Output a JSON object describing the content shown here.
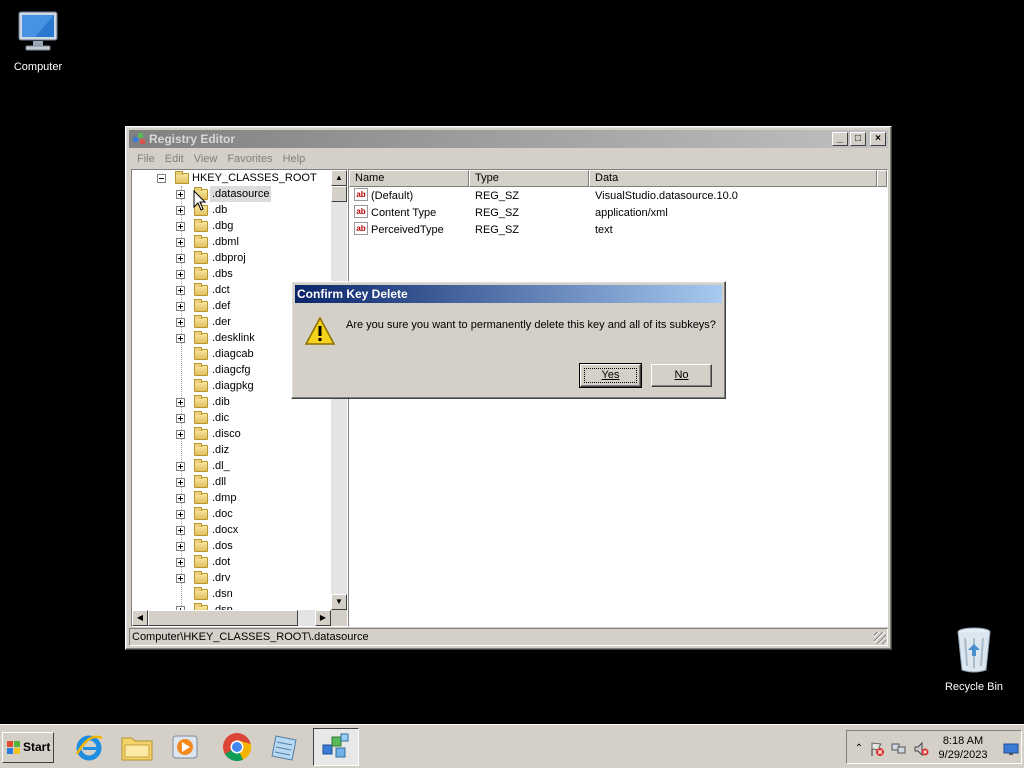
{
  "desktop": {
    "computer_label": "Computer",
    "recycle_label": "Recycle Bin"
  },
  "window": {
    "title": "Registry Editor",
    "menu": [
      "File",
      "Edit",
      "View",
      "Favorites",
      "Help"
    ],
    "controls": {
      "minimize": "_",
      "maximize": "□",
      "close": "×"
    },
    "tree": {
      "root": "HKEY_CLASSES_ROOT",
      "selected_index": 0,
      "items": [
        {
          "label": ".datasource",
          "expandable": true
        },
        {
          "label": ".db",
          "expandable": true
        },
        {
          "label": ".dbg",
          "expandable": true
        },
        {
          "label": ".dbml",
          "expandable": true
        },
        {
          "label": ".dbproj",
          "expandable": true
        },
        {
          "label": ".dbs",
          "expandable": true
        },
        {
          "label": ".dct",
          "expandable": true
        },
        {
          "label": ".def",
          "expandable": true
        },
        {
          "label": ".der",
          "expandable": true
        },
        {
          "label": ".desklink",
          "expandable": true
        },
        {
          "label": ".diagcab",
          "expandable": false
        },
        {
          "label": ".diagcfg",
          "expandable": false
        },
        {
          "label": ".diagpkg",
          "expandable": false
        },
        {
          "label": ".dib",
          "expandable": true
        },
        {
          "label": ".dic",
          "expandable": true
        },
        {
          "label": ".disco",
          "expandable": true
        },
        {
          "label": ".diz",
          "expandable": false
        },
        {
          "label": ".dl_",
          "expandable": true
        },
        {
          "label": ".dll",
          "expandable": true
        },
        {
          "label": ".dmp",
          "expandable": true
        },
        {
          "label": ".doc",
          "expandable": true
        },
        {
          "label": ".docx",
          "expandable": true
        },
        {
          "label": ".dos",
          "expandable": true
        },
        {
          "label": ".dot",
          "expandable": true
        },
        {
          "label": ".drv",
          "expandable": true
        },
        {
          "label": ".dsn",
          "expandable": false
        },
        {
          "label": ".dsp",
          "expandable": true
        }
      ]
    },
    "list": {
      "columns": [
        "Name",
        "Type",
        "Data"
      ],
      "rows": [
        {
          "name": "(Default)",
          "type": "REG_SZ",
          "data": "VisualStudio.datasource.10.0"
        },
        {
          "name": "Content Type",
          "type": "REG_SZ",
          "data": "application/xml"
        },
        {
          "name": "PerceivedType",
          "type": "REG_SZ",
          "data": "text"
        }
      ]
    },
    "status": "Computer\\HKEY_CLASSES_ROOT\\.datasource"
  },
  "dialog": {
    "title": "Confirm Key Delete",
    "message": "Are you sure you want to permanently delete this key and all of its subkeys?",
    "yes_label": "Yes",
    "no_label": "No"
  },
  "taskbar": {
    "start_label": "Start",
    "apps": [
      "internet-explorer",
      "file-explorer",
      "media-player",
      "chrome",
      "notepad",
      "registry-editor"
    ],
    "active_app": "registry-editor",
    "clock_time": "8:18 AM",
    "clock_date": "9/29/2023"
  }
}
